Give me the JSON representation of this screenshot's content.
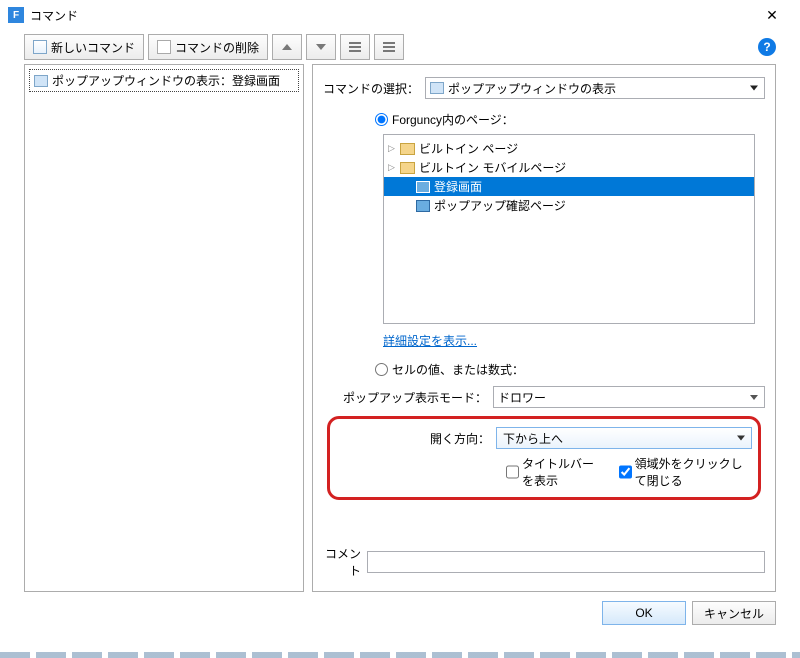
{
  "title": "コマンド",
  "toolbar": {
    "new_command": "新しいコマンド",
    "delete_command": "コマンドの削除"
  },
  "left_tree": {
    "item0": "ポップアップウィンドウの表示：登録画面"
  },
  "right": {
    "select_label": "コマンドの選択：",
    "selected_command": "ポップアップウィンドウの表示",
    "radio_page": "Forguncy内のページ：",
    "radio_cell": "セルの値、または数式：",
    "pages": {
      "builtin": "ビルトイン ページ",
      "mobile": "ビルトイン モバイルページ",
      "register": "登録画面",
      "confirm": "ポップアップ確認ページ"
    },
    "advanced": "詳細設定を表示...",
    "mode_label": "ポップアップ表示モード：",
    "mode_value": "ドロワー",
    "dir_label": "開く方向：",
    "dir_value": "下から上へ",
    "show_titlebar": "タイトルバーを表示",
    "close_outside": "領域外をクリックして閉じる",
    "comment_label": "コメント"
  },
  "footer": {
    "ok": "OK",
    "cancel": "キャンセル"
  }
}
